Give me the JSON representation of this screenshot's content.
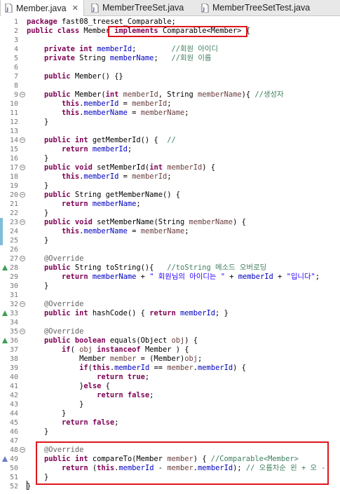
{
  "tabs": [
    {
      "label": "Member.java",
      "close": "✕",
      "active": true
    },
    {
      "label": "MemberTreeSet.java",
      "active": false
    },
    {
      "label": "MemberTreeSetTest.java",
      "active": false
    }
  ],
  "lines": [
    {
      "n": "1",
      "html": "<span class=\"kw\">package</span> fast08_treeset_Comparable;"
    },
    {
      "n": "2",
      "html": "<span class=\"kw\">public class</span> Member <span class=\"kw\">implements</span> Comparable&lt;Member&gt; {"
    },
    {
      "n": "3",
      "html": ""
    },
    {
      "n": "4",
      "html": "    <span class=\"kw\">private int</span> <span class=\"fld\">memberId</span>;        <span class=\"cm\">//회원 아이디</span>"
    },
    {
      "n": "5",
      "html": "    <span class=\"kw\">private</span> String <span class=\"fld\">memberName</span>;   <span class=\"cm\">//회원 이름</span>"
    },
    {
      "n": "6",
      "html": ""
    },
    {
      "n": "7",
      "html": "    <span class=\"kw\">public</span> Member() {}"
    },
    {
      "n": "8",
      "html": ""
    },
    {
      "n": "9",
      "fold": true,
      "html": "    <span class=\"kw\">public</span> Member(<span class=\"kw\">int</span> <span class=\"par\">memberId</span>, String <span class=\"par\">memberName</span>){ <span class=\"cm\">//생성자</span>"
    },
    {
      "n": "10",
      "html": "        <span class=\"kw\">this</span>.<span class=\"fld\">memberId</span> = <span class=\"par\">memberId</span>;"
    },
    {
      "n": "11",
      "html": "        <span class=\"kw\">this</span>.<span class=\"fld\">memberName</span> = <span class=\"par\">memberName</span>;"
    },
    {
      "n": "12",
      "html": "    }"
    },
    {
      "n": "13",
      "html": ""
    },
    {
      "n": "14",
      "fold": true,
      "html": "    <span class=\"kw\">public int</span> getMemberId() {  <span class=\"cm\">//</span>"
    },
    {
      "n": "15",
      "html": "        <span class=\"kw\">return</span> <span class=\"fld\">memberId</span>;"
    },
    {
      "n": "16",
      "html": "    }"
    },
    {
      "n": "17",
      "fold": true,
      "html": "    <span class=\"kw\">public void</span> setMemberId(<span class=\"kw\">int</span> <span class=\"par\">memberId</span>) {"
    },
    {
      "n": "18",
      "html": "        <span class=\"kw\">this</span>.<span class=\"fld\">memberId</span> = <span class=\"par\">memberId</span>;"
    },
    {
      "n": "19",
      "html": "    }"
    },
    {
      "n": "20",
      "fold": true,
      "html": "    <span class=\"kw\">public</span> String getMemberName() {"
    },
    {
      "n": "21",
      "html": "        <span class=\"kw\">return</span> <span class=\"fld\">memberName</span>;"
    },
    {
      "n": "22",
      "html": "    }"
    },
    {
      "n": "23",
      "fold": true,
      "marker": true,
      "html": "    <span class=\"kw\">public void</span> setMemberName(String <span class=\"par\">memberName</span>) {"
    },
    {
      "n": "24",
      "marker": true,
      "html": "        <span class=\"kw\">this</span>.<span class=\"fld\">memberName</span> = <span class=\"par\">memberName</span>;"
    },
    {
      "n": "25",
      "marker": true,
      "html": "    }"
    },
    {
      "n": "26",
      "html": ""
    },
    {
      "n": "27",
      "fold": true,
      "html": "    <span class=\"ann\">@Override</span>"
    },
    {
      "n": "28",
      "warn": "green",
      "html": "    <span class=\"kw\">public</span> String toString(){   <span class=\"cm\">//toString 메소드 오버로딩</span>"
    },
    {
      "n": "29",
      "html": "        <span class=\"kw\">return</span> <span class=\"fld\">memberName</span> + <span class=\"str\">\" 회원님의 아이디는 \"</span> + <span class=\"fld\">memberId</span> + <span class=\"str\">\"입니다\"</span>;"
    },
    {
      "n": "30",
      "html": "    }"
    },
    {
      "n": "31",
      "html": ""
    },
    {
      "n": "32",
      "fold": true,
      "html": "    <span class=\"ann\">@Override</span>"
    },
    {
      "n": "33",
      "warn": "green",
      "html": "    <span class=\"kw\">public int</span> hashCode() { <span class=\"kw\">return</span> <span class=\"fld\">memberId</span>; }"
    },
    {
      "n": "34",
      "html": ""
    },
    {
      "n": "35",
      "fold": true,
      "html": "    <span class=\"ann\">@Override</span>"
    },
    {
      "n": "36",
      "warn": "green",
      "html": "    <span class=\"kw\">public boolean</span> equals(Object <span class=\"par\">obj</span>) {"
    },
    {
      "n": "37",
      "html": "        <span class=\"kw\">if</span>( <span class=\"par\">obj</span> <span class=\"kw\">instanceof</span> Member ) {"
    },
    {
      "n": "38",
      "html": "            Member <span class=\"par\">member</span> = (Member)<span class=\"par\">obj</span>;"
    },
    {
      "n": "39",
      "html": "            <span class=\"kw\">if</span>(<span class=\"kw\">this</span>.<span class=\"fld\">memberId</span> == <span class=\"par\">member</span>.<span class=\"fld\">memberId</span>) {"
    },
    {
      "n": "40",
      "html": "                <span class=\"kw\">return true</span>;"
    },
    {
      "n": "41",
      "html": "            }<span class=\"kw\">else</span> {"
    },
    {
      "n": "42",
      "html": "                <span class=\"kw\">return false</span>;"
    },
    {
      "n": "43",
      "html": "            }"
    },
    {
      "n": "44",
      "html": "        }"
    },
    {
      "n": "45",
      "html": "        <span class=\"kw\">return false</span>;"
    },
    {
      "n": "46",
      "html": "    }"
    },
    {
      "n": "47",
      "html": ""
    },
    {
      "n": "48",
      "fold": true,
      "html": "    <span class=\"ann\">@Override</span>"
    },
    {
      "n": "49",
      "warn": "blue",
      "html": "    <span class=\"kw\">public int</span> compareTo(Member <span class=\"par\">member</span>) { <span class=\"cm\">//Comparable&lt;Member&gt;</span>"
    },
    {
      "n": "50",
      "html": "        <span class=\"kw\">return</span> (<span class=\"kw\">this</span>.<span class=\"fld\">memberId</span> - <span class=\"par\">member</span>.<span class=\"fld\">memberId</span>); <span class=\"cm\">// 오름차순 왼 + 오 -</span>"
    },
    {
      "n": "51",
      "html": "    }"
    },
    {
      "n": "52",
      "html": "}"
    }
  ]
}
